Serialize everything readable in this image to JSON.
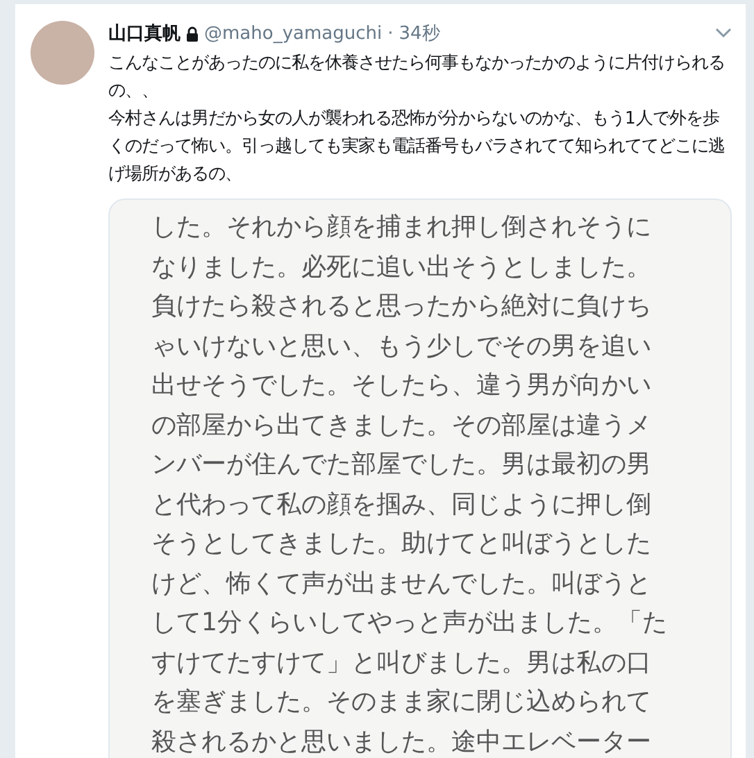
{
  "tweet": {
    "display_name": "山口真帆",
    "protected": true,
    "handle": "@maho_yamaguchi",
    "separator": "·",
    "time": "34秒",
    "paragraphs": [
      "こんなことがあったのに私を休養させたら何事もなかったかのように片付けられるの、、",
      "今村さんは男だから女の人が襲われる恐怖が分からないのかな、もう1人で外を歩くのだって怖い。引っ越しても実家も電話番号もバラされてて知られててどこに逃げ場所があるの、"
    ],
    "image_lines": [
      "した。それから顔を捕まれ押し倒されそうに",
      "なりました。必死に追い出そうとしました。",
      "負けたら殺されると思ったから絶対に負けち",
      "ゃいけないと思い、もう少しでその男を追い",
      "出せそうでした。そしたら、違う男が向かい",
      "の部屋から出てきました。その部屋は違うメ",
      "ンバーが住んでた部屋でした。男は最初の男",
      "と代わって私の顔を掴み、同じように押し倒",
      "そうとしてきました。助けてと叫ぼうとした",
      "けど、怖くて声が出ませんでした。叫ぼうと",
      "して1分くらいしてやっと声が出ました。「た",
      "すけてたすけて」と叫びました。男は私の口",
      "を塞ぎました。そのまま家に閉じ込められて",
      "殺されるかと思いました。途中エレベーター"
    ]
  }
}
